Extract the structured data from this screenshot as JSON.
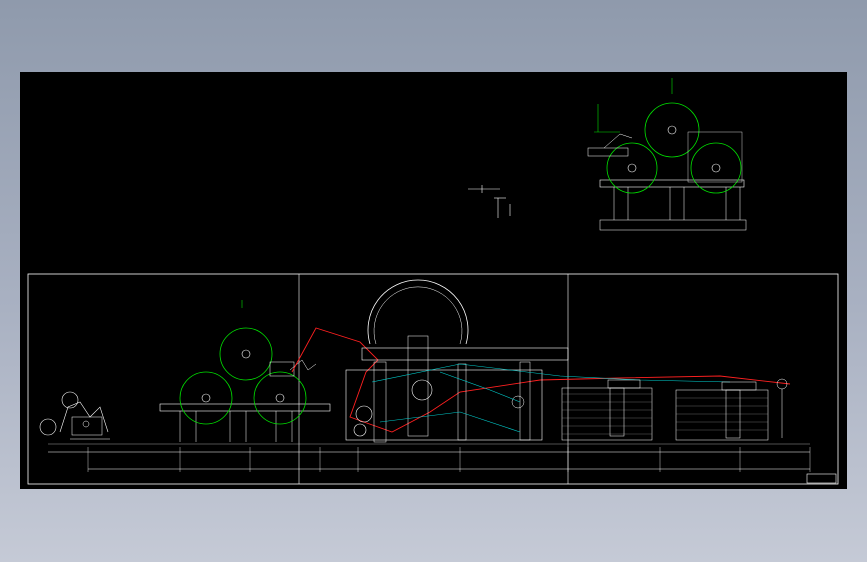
{
  "drawing": {
    "title_block_label": "",
    "colors": {
      "background": "#000000",
      "frame": "#ffffff",
      "geometry": "#00e000",
      "dimension": "#00e0e0",
      "web_path": "#ff2020",
      "outline": "#e0e0e0",
      "window_bg_top": "#8f9aac",
      "window_bg_bottom": "#c5cad6"
    }
  }
}
